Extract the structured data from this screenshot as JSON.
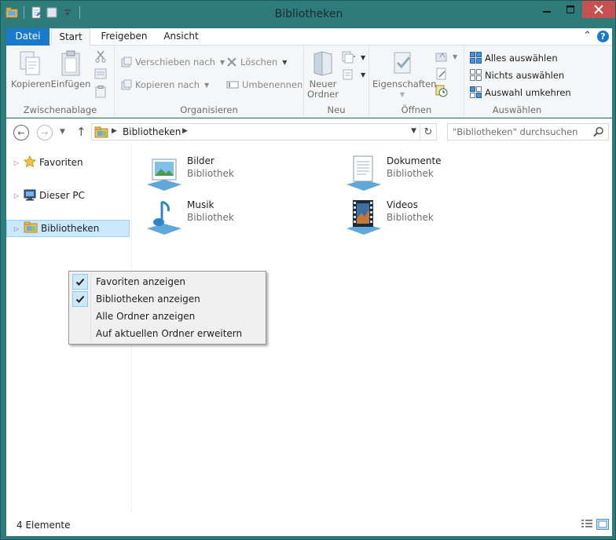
{
  "window": {
    "title": "Bibliotheken"
  },
  "ribbon_tabs": {
    "datei": "Datei",
    "start": "Start",
    "freigeben": "Freigeben",
    "ansicht": "Ansicht",
    "help": "?"
  },
  "ribbon": {
    "clipboard": {
      "copy": "Kopieren",
      "paste": "Einfügen",
      "label": "Zwischenablage"
    },
    "organize": {
      "move_to": "Verschieben nach",
      "copy_to": "Kopieren nach",
      "delete": "Löschen",
      "rename": "Umbenennen",
      "label": "Organisieren"
    },
    "new": {
      "new_folder_line1": "Neuer",
      "new_folder_line2": "Ordner",
      "label": "Neu"
    },
    "open": {
      "properties": "Eigenschaften",
      "label": "Öffnen"
    },
    "select": {
      "select_all": "Alles auswählen",
      "select_none": "Nichts auswählen",
      "invert": "Auswahl umkehren",
      "label": "Auswählen"
    }
  },
  "address_bar": {
    "path": "Bibliotheken",
    "search_placeholder": "\"Bibliotheken\" durchsuchen"
  },
  "nav_tree": {
    "favorites": "Favoriten",
    "this_pc": "Dieser PC",
    "libraries": "Bibliotheken"
  },
  "libraries": [
    {
      "name": "Bilder",
      "type": "Bibliothek",
      "icon": "pictures-library-icon"
    },
    {
      "name": "Dokumente",
      "type": "Bibliothek",
      "icon": "documents-library-icon"
    },
    {
      "name": "Musik",
      "type": "Bibliothek",
      "icon": "music-library-icon"
    },
    {
      "name": "Videos",
      "type": "Bibliothek",
      "icon": "videos-library-icon"
    }
  ],
  "context_menu": {
    "items": [
      {
        "label": "Favoriten anzeigen",
        "checked": true
      },
      {
        "label": "Bibliotheken anzeigen",
        "checked": true
      },
      {
        "label": "Alle Ordner anzeigen",
        "checked": false
      },
      {
        "label": "Auf aktuellen Ordner erweitern",
        "checked": false
      }
    ]
  },
  "status_bar": {
    "item_count": "4 Elemente"
  },
  "colors": {
    "frame": "#2e7b7c",
    "accent": "#1979ca",
    "close": "#c75050",
    "selection": "#cce8ff"
  }
}
